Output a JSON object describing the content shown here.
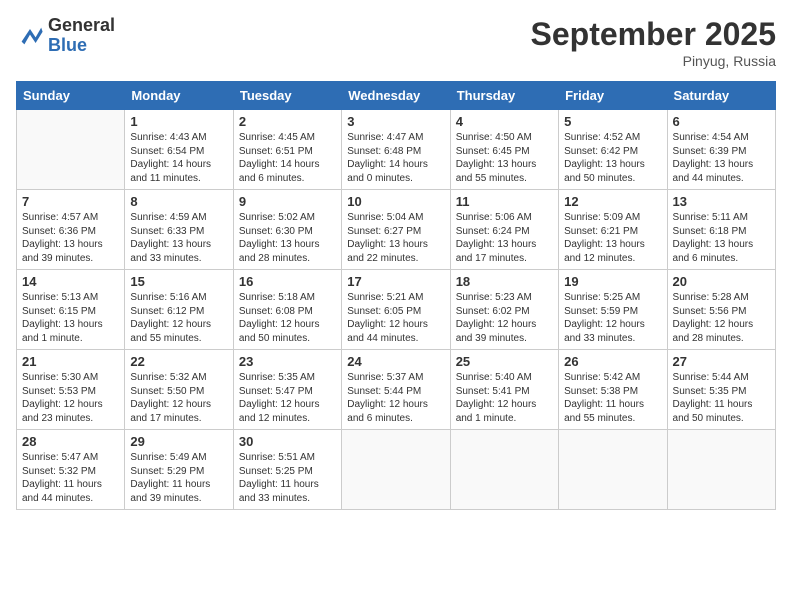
{
  "header": {
    "logo_general": "General",
    "logo_blue": "Blue",
    "month_title": "September 2025",
    "subtitle": "Pinyug, Russia"
  },
  "days": [
    "Sunday",
    "Monday",
    "Tuesday",
    "Wednesday",
    "Thursday",
    "Friday",
    "Saturday"
  ],
  "weeks": [
    [
      {
        "date": "",
        "info": ""
      },
      {
        "date": "1",
        "info": "Sunrise: 4:43 AM\nSunset: 6:54 PM\nDaylight: 14 hours\nand 11 minutes."
      },
      {
        "date": "2",
        "info": "Sunrise: 4:45 AM\nSunset: 6:51 PM\nDaylight: 14 hours\nand 6 minutes."
      },
      {
        "date": "3",
        "info": "Sunrise: 4:47 AM\nSunset: 6:48 PM\nDaylight: 14 hours\nand 0 minutes."
      },
      {
        "date": "4",
        "info": "Sunrise: 4:50 AM\nSunset: 6:45 PM\nDaylight: 13 hours\nand 55 minutes."
      },
      {
        "date": "5",
        "info": "Sunrise: 4:52 AM\nSunset: 6:42 PM\nDaylight: 13 hours\nand 50 minutes."
      },
      {
        "date": "6",
        "info": "Sunrise: 4:54 AM\nSunset: 6:39 PM\nDaylight: 13 hours\nand 44 minutes."
      }
    ],
    [
      {
        "date": "7",
        "info": "Sunrise: 4:57 AM\nSunset: 6:36 PM\nDaylight: 13 hours\nand 39 minutes."
      },
      {
        "date": "8",
        "info": "Sunrise: 4:59 AM\nSunset: 6:33 PM\nDaylight: 13 hours\nand 33 minutes."
      },
      {
        "date": "9",
        "info": "Sunrise: 5:02 AM\nSunset: 6:30 PM\nDaylight: 13 hours\nand 28 minutes."
      },
      {
        "date": "10",
        "info": "Sunrise: 5:04 AM\nSunset: 6:27 PM\nDaylight: 13 hours\nand 22 minutes."
      },
      {
        "date": "11",
        "info": "Sunrise: 5:06 AM\nSunset: 6:24 PM\nDaylight: 13 hours\nand 17 minutes."
      },
      {
        "date": "12",
        "info": "Sunrise: 5:09 AM\nSunset: 6:21 PM\nDaylight: 13 hours\nand 12 minutes."
      },
      {
        "date": "13",
        "info": "Sunrise: 5:11 AM\nSunset: 6:18 PM\nDaylight: 13 hours\nand 6 minutes."
      }
    ],
    [
      {
        "date": "14",
        "info": "Sunrise: 5:13 AM\nSunset: 6:15 PM\nDaylight: 13 hours\nand 1 minute."
      },
      {
        "date": "15",
        "info": "Sunrise: 5:16 AM\nSunset: 6:12 PM\nDaylight: 12 hours\nand 55 minutes."
      },
      {
        "date": "16",
        "info": "Sunrise: 5:18 AM\nSunset: 6:08 PM\nDaylight: 12 hours\nand 50 minutes."
      },
      {
        "date": "17",
        "info": "Sunrise: 5:21 AM\nSunset: 6:05 PM\nDaylight: 12 hours\nand 44 minutes."
      },
      {
        "date": "18",
        "info": "Sunrise: 5:23 AM\nSunset: 6:02 PM\nDaylight: 12 hours\nand 39 minutes."
      },
      {
        "date": "19",
        "info": "Sunrise: 5:25 AM\nSunset: 5:59 PM\nDaylight: 12 hours\nand 33 minutes."
      },
      {
        "date": "20",
        "info": "Sunrise: 5:28 AM\nSunset: 5:56 PM\nDaylight: 12 hours\nand 28 minutes."
      }
    ],
    [
      {
        "date": "21",
        "info": "Sunrise: 5:30 AM\nSunset: 5:53 PM\nDaylight: 12 hours\nand 23 minutes."
      },
      {
        "date": "22",
        "info": "Sunrise: 5:32 AM\nSunset: 5:50 PM\nDaylight: 12 hours\nand 17 minutes."
      },
      {
        "date": "23",
        "info": "Sunrise: 5:35 AM\nSunset: 5:47 PM\nDaylight: 12 hours\nand 12 minutes."
      },
      {
        "date": "24",
        "info": "Sunrise: 5:37 AM\nSunset: 5:44 PM\nDaylight: 12 hours\nand 6 minutes."
      },
      {
        "date": "25",
        "info": "Sunrise: 5:40 AM\nSunset: 5:41 PM\nDaylight: 12 hours\nand 1 minute."
      },
      {
        "date": "26",
        "info": "Sunrise: 5:42 AM\nSunset: 5:38 PM\nDaylight: 11 hours\nand 55 minutes."
      },
      {
        "date": "27",
        "info": "Sunrise: 5:44 AM\nSunset: 5:35 PM\nDaylight: 11 hours\nand 50 minutes."
      }
    ],
    [
      {
        "date": "28",
        "info": "Sunrise: 5:47 AM\nSunset: 5:32 PM\nDaylight: 11 hours\nand 44 minutes."
      },
      {
        "date": "29",
        "info": "Sunrise: 5:49 AM\nSunset: 5:29 PM\nDaylight: 11 hours\nand 39 minutes."
      },
      {
        "date": "30",
        "info": "Sunrise: 5:51 AM\nSunset: 5:25 PM\nDaylight: 11 hours\nand 33 minutes."
      },
      {
        "date": "",
        "info": ""
      },
      {
        "date": "",
        "info": ""
      },
      {
        "date": "",
        "info": ""
      },
      {
        "date": "",
        "info": ""
      }
    ]
  ]
}
